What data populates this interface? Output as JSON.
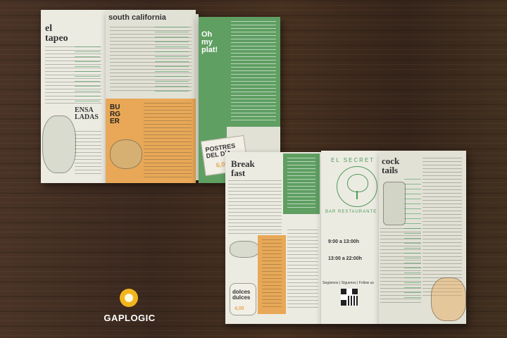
{
  "brochure_back": {
    "el_tapeo_title": "el tapeo",
    "south_california_title": "south california",
    "ensaladas_title": "ENSA LADAS",
    "burger_title": "BURGER",
    "oh_my_plat_title": "Oh my plat!",
    "postres_title": "POSTRES DEL DÍA",
    "postres_price": "6,00"
  },
  "brochure_front": {
    "breakfast_title": "Break fast",
    "cocktails_title": "cock tails",
    "brand_top": "EL SECRET",
    "brand_bottom": "BAR RESTAURANTE",
    "hours_morning": "9:00 a 13:00h",
    "hours_evening": "13:00 a 22:00h",
    "social": "Segúenos | Síguenos | Follow us",
    "dulces_title": "dolces dulces",
    "dulces_price": "4,00"
  },
  "watermark": {
    "brand": "GAPLOGIC",
    "icon": "gaplogic-logo-icon"
  },
  "colors": {
    "green": "#5f9f62",
    "orange": "#e8a857",
    "paper": "#ecebe2",
    "wood": "#3b2a20"
  }
}
